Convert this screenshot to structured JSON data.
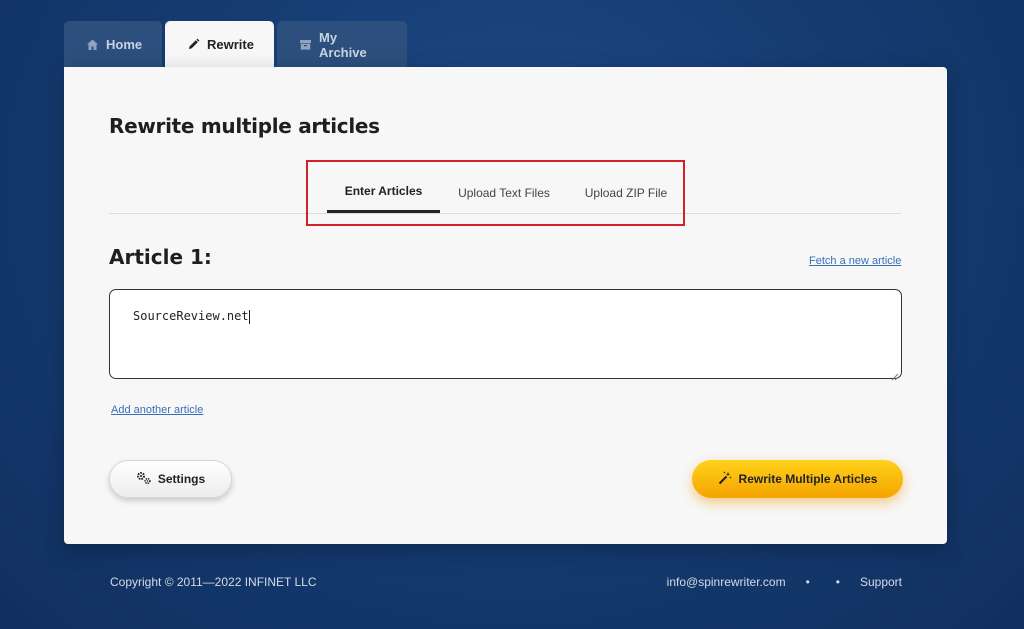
{
  "nav": {
    "tabs": [
      {
        "label": "Home",
        "icon": "home-icon"
      },
      {
        "label": "Rewrite",
        "icon": "pencil-icon"
      },
      {
        "label": "My Archive",
        "icon": "archive-icon"
      }
    ],
    "active_index": 1
  },
  "main": {
    "title": "Rewrite multiple articles",
    "input_tabs": [
      "Enter Articles",
      "Upload Text Files",
      "Upload ZIP File"
    ],
    "active_input_tab": 0,
    "article_heading": "Article 1:",
    "fetch_link": "Fetch a new article",
    "article_value": "SourceReview.net",
    "add_link": "Add another article",
    "settings_label": "Settings",
    "rewrite_label": "Rewrite Multiple Articles"
  },
  "footer": {
    "copyright": "Copyright © 2011—2022 INFINET LLC",
    "email": "info@spinrewriter.com",
    "support": "Support"
  },
  "colors": {
    "background": "#163c73",
    "accent_button": "#ffc107",
    "highlight_box": "#d4202a",
    "link": "#3a6fb5"
  }
}
